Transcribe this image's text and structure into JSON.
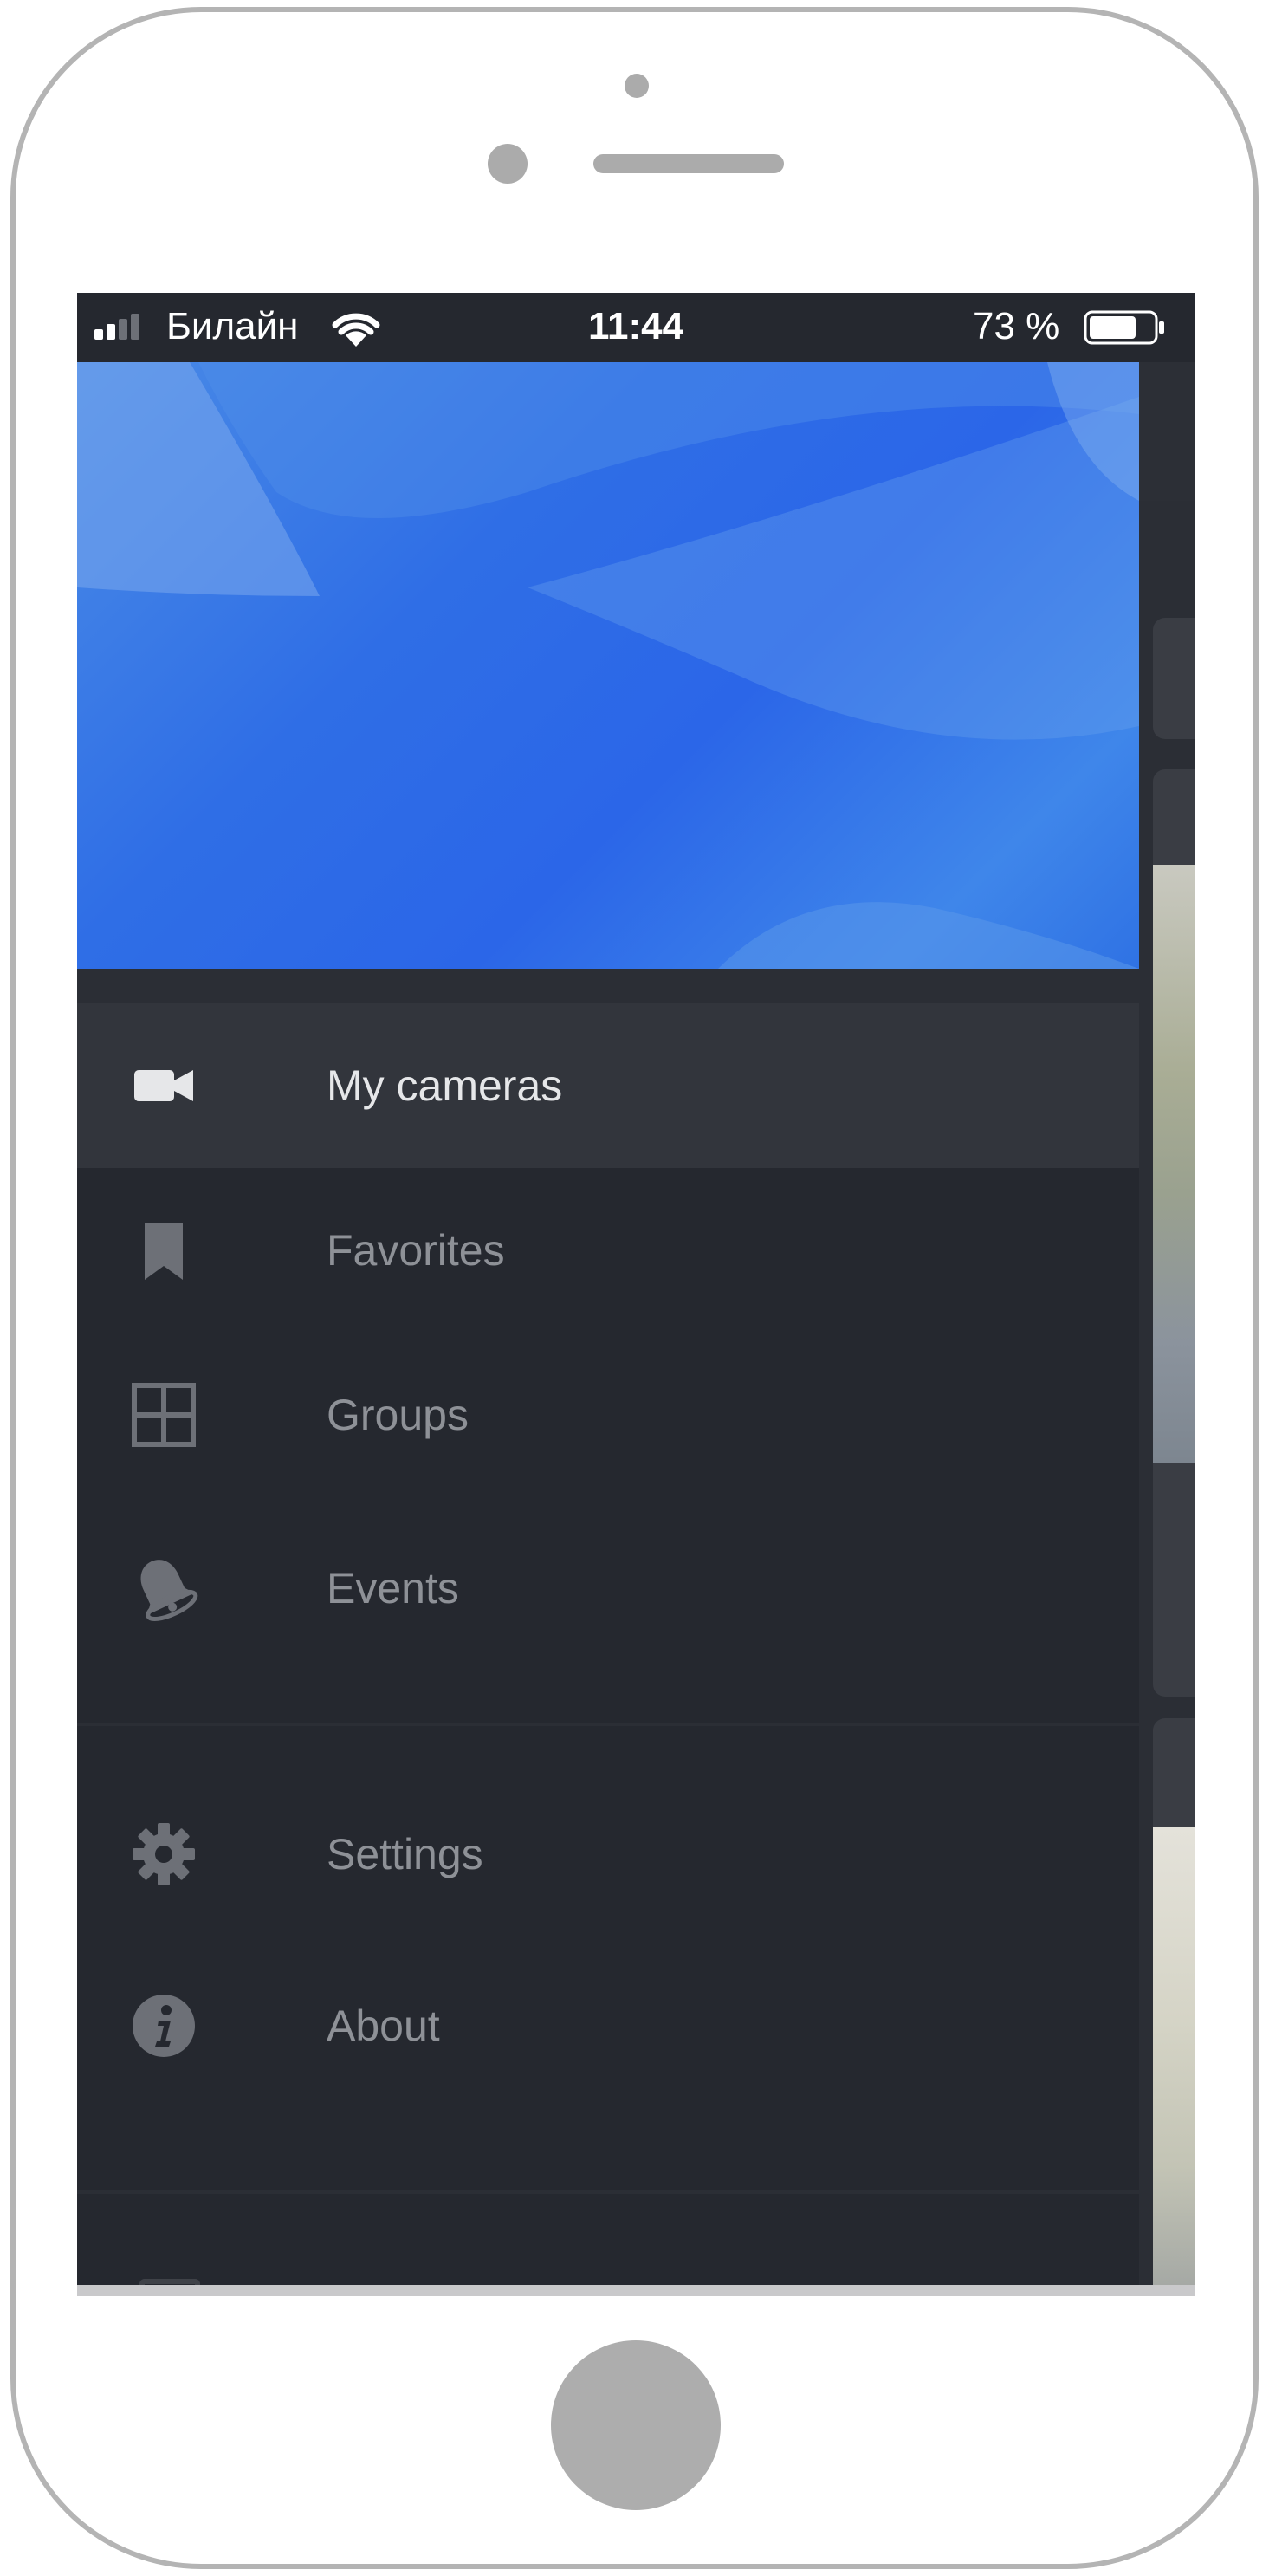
{
  "status_bar": {
    "carrier": "Билайн",
    "time": "11:44",
    "battery_percent": "73 %",
    "battery_level": 0.73,
    "signal_bars": 2
  },
  "drawer": {
    "sections": [
      {
        "items": [
          {
            "label": "My cameras",
            "icon": "video-camera-icon",
            "active": true
          },
          {
            "label": "Favorites",
            "icon": "bookmark-icon",
            "active": false
          },
          {
            "label": "Groups",
            "icon": "grid-icon",
            "active": false
          },
          {
            "label": "Events",
            "icon": "bell-icon",
            "active": false
          }
        ]
      },
      {
        "items": [
          {
            "label": "Settings",
            "icon": "gear-icon",
            "active": false
          },
          {
            "label": "About",
            "icon": "info-icon",
            "active": false
          }
        ]
      }
    ]
  },
  "colors": {
    "drawer_background": "#25282f",
    "active_item_background": "#32353c",
    "header_blue": "#2b66e8",
    "active_text": "#e6e7e9",
    "inactive_text": "#8e9197",
    "inactive_icon": "#6d7077"
  }
}
